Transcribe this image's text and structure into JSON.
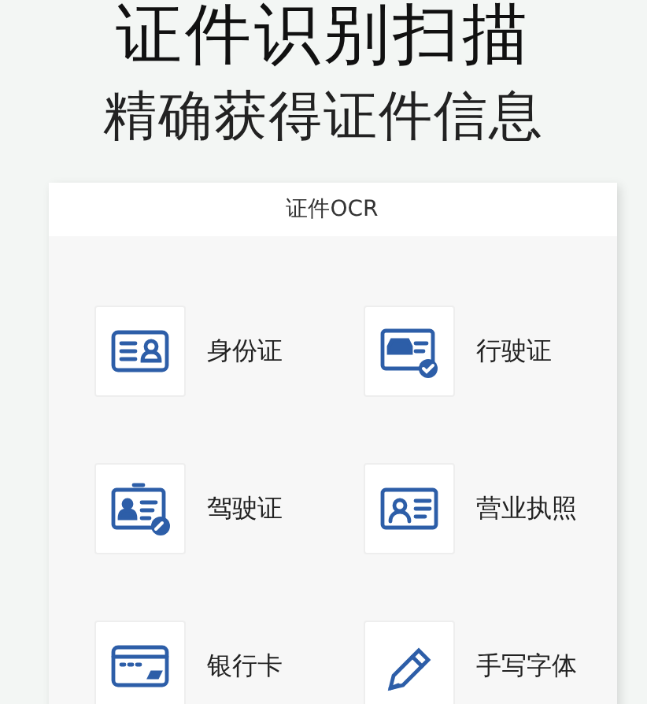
{
  "title": "证件识别扫描",
  "subtitle": "精确获得证件信息",
  "panel": {
    "title": "证件OCR",
    "items": [
      {
        "kind": "id_card",
        "label": "身份证"
      },
      {
        "kind": "vehicle_license",
        "label": "行驶证"
      },
      {
        "kind": "driver_license",
        "label": "驾驶证"
      },
      {
        "kind": "business_license",
        "label": "营业执照"
      },
      {
        "kind": "bank_card",
        "label": "银行卡"
      },
      {
        "kind": "handwriting",
        "label": "手写字体"
      }
    ]
  }
}
